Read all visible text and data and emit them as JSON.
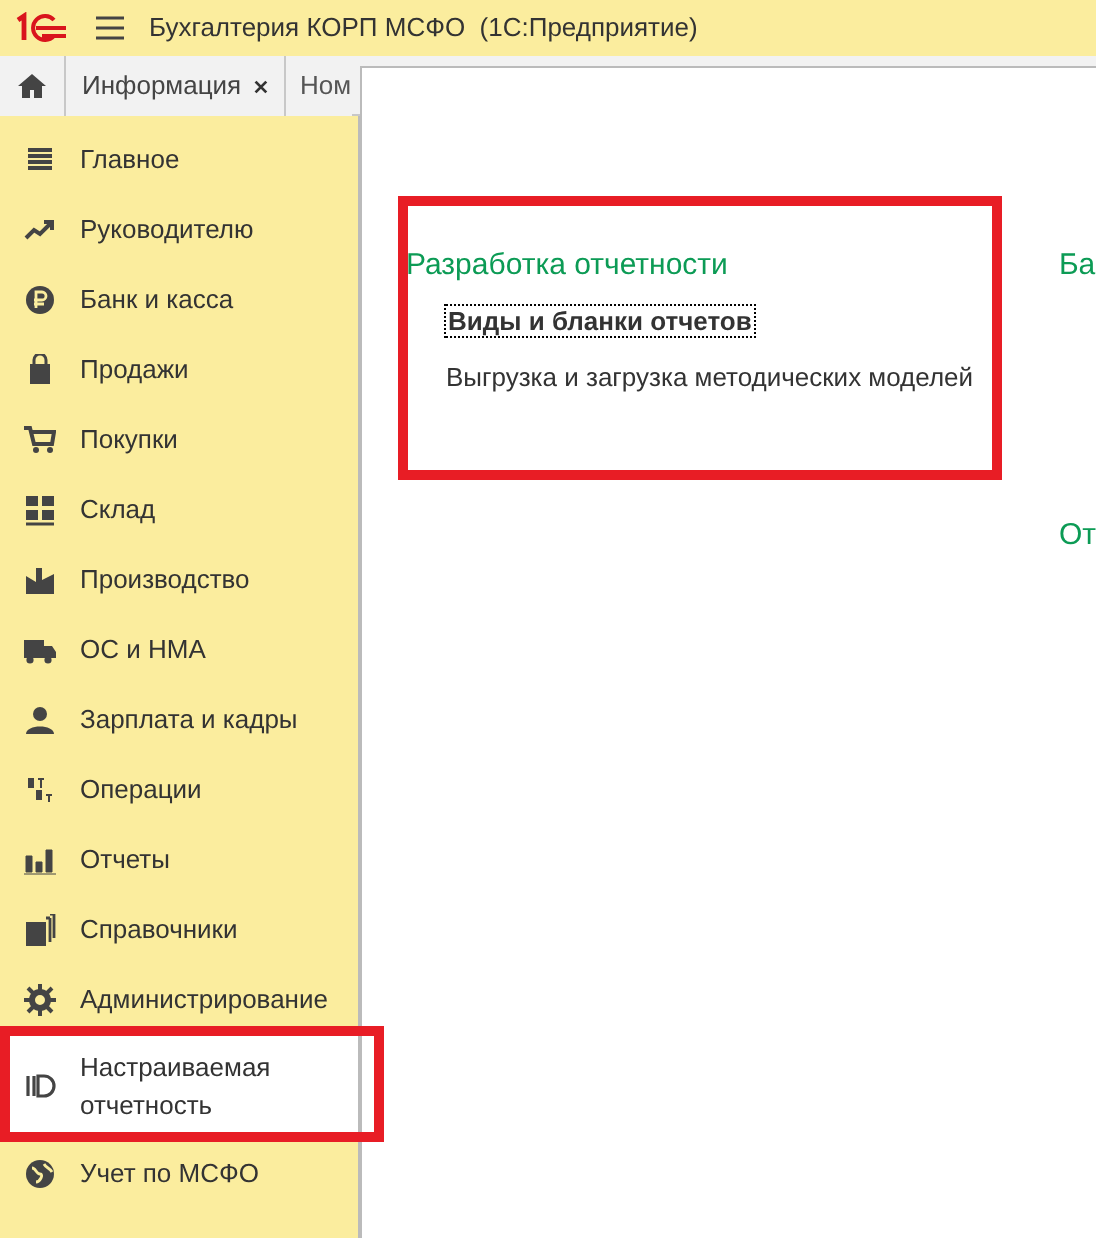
{
  "window": {
    "title": "Бухгалтерия КОРП МСФО  (1С:Предприятие)"
  },
  "tabs": [
    {
      "label": "Информация",
      "selected": true,
      "closable": true
    },
    {
      "label": "Ном",
      "selected": false,
      "closable": false
    }
  ],
  "sidebar": {
    "items": [
      {
        "label": "Главное",
        "selected": false
      },
      {
        "label": "Руководителю",
        "selected": false
      },
      {
        "label": "Банк и касса",
        "selected": false
      },
      {
        "label": "Продажи",
        "selected": false
      },
      {
        "label": "Покупки",
        "selected": false
      },
      {
        "label": "Склад",
        "selected": false
      },
      {
        "label": "Производство",
        "selected": false
      },
      {
        "label": "ОС и НМА",
        "selected": false
      },
      {
        "label": "Зарплата и кадры",
        "selected": false
      },
      {
        "label": "Операции",
        "selected": false
      },
      {
        "label": "Отчеты",
        "selected": false
      },
      {
        "label": "Справочники",
        "selected": false
      },
      {
        "label": "Администрирование",
        "selected": false
      },
      {
        "label": "Настраиваемая отчетность",
        "selected": true
      },
      {
        "label": "Учет по МСФО",
        "selected": false
      }
    ]
  },
  "content": {
    "groups": [
      {
        "title": "Разработка отчетности",
        "links": [
          {
            "label": "Виды и бланки отчетов",
            "focused": true
          },
          {
            "label": "Выгрузка и загрузка методических моделей",
            "focused": false
          }
        ]
      }
    ],
    "side_headings": [
      "Ба",
      "От"
    ]
  }
}
